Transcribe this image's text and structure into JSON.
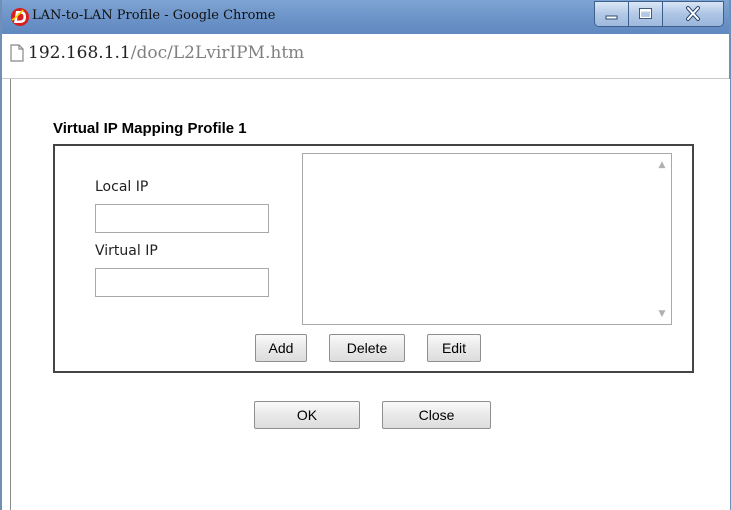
{
  "window": {
    "title": "LAN-to-LAN Profile - Google Chrome",
    "icon": "draytek-d-icon",
    "controls": {
      "minimize": "minimize-icon",
      "maximize": "maximize-icon",
      "close": "close-icon"
    }
  },
  "address": {
    "host": "192.168.1.1",
    "path": "/doc/L2LvirIPM.htm",
    "icon": "page-icon"
  },
  "profile": {
    "title": "Virtual IP Mapping Profile 1",
    "local_ip_label": "Local IP",
    "local_ip_value": "",
    "virtual_ip_label": "Virtual IP",
    "virtual_ip_value": "",
    "list_items": [],
    "add_label": "Add",
    "delete_label": "Delete",
    "edit_label": "Edit"
  },
  "footer": {
    "ok_label": "OK",
    "close_label": "Close"
  },
  "colors": {
    "titlebar": "#6b93c8",
    "window_border": "#6f8fb6",
    "url_path": "#808080"
  }
}
